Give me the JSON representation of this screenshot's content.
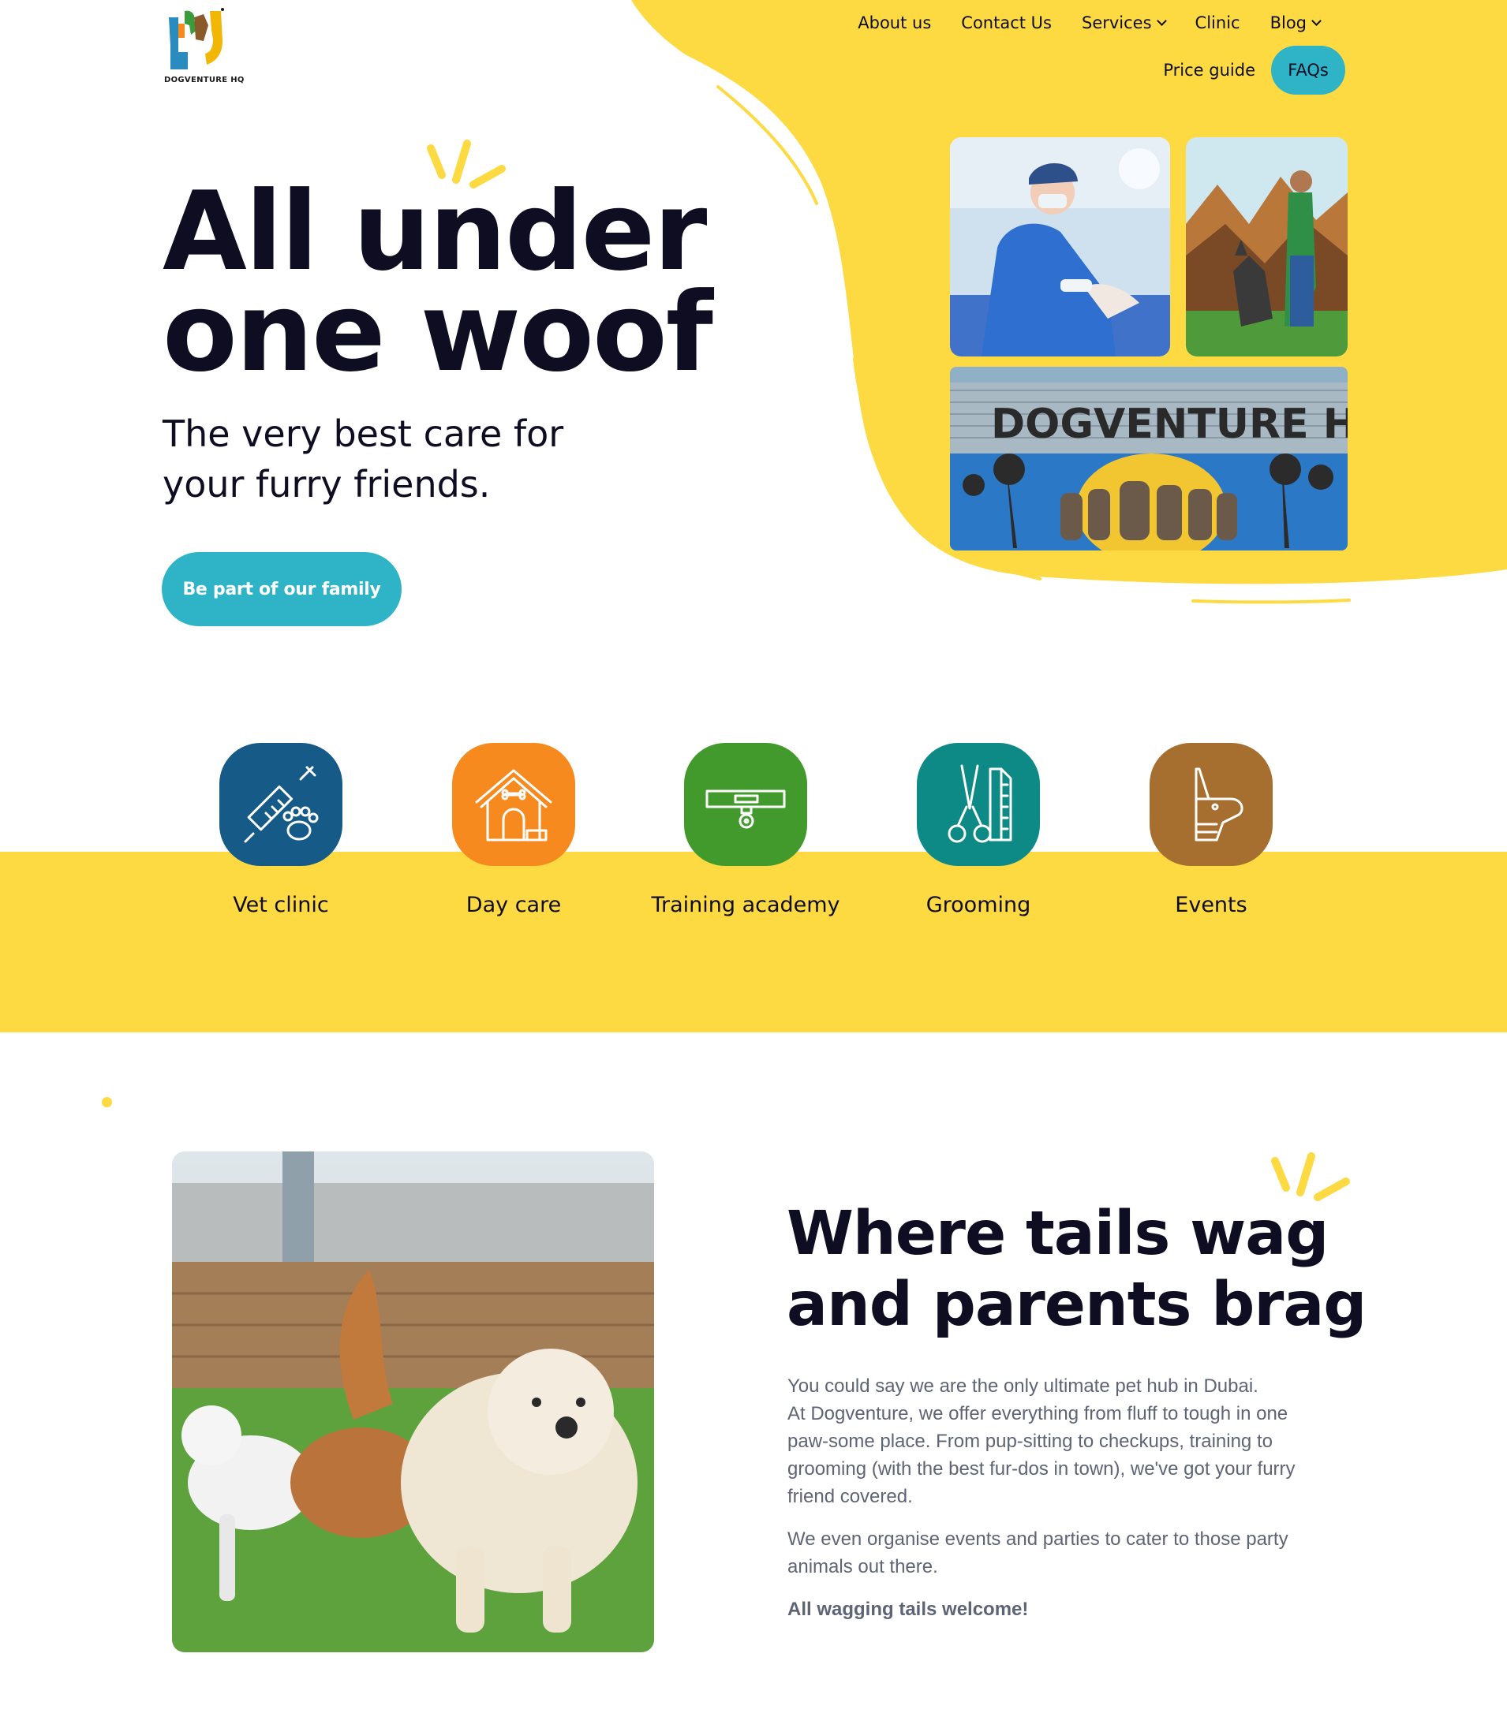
{
  "brand": {
    "logo_text": "DOGVENTURE HQ",
    "colors": {
      "yellow": "#fdd942",
      "teal": "#2fb3c6",
      "navy": "#0f0d22",
      "text_gray": "#5d6475"
    }
  },
  "nav": {
    "items": [
      {
        "label": "About us",
        "has_dropdown": false
      },
      {
        "label": "Contact Us",
        "has_dropdown": false
      },
      {
        "label": "Services",
        "has_dropdown": true
      },
      {
        "label": "Clinic",
        "has_dropdown": false
      },
      {
        "label": "Blog",
        "has_dropdown": true
      }
    ],
    "price_guide": "Price guide",
    "faqs": "FAQs"
  },
  "hero": {
    "title_line1": "All under",
    "title_line2": "one woof",
    "subtitle_line1": "The very best care for",
    "subtitle_line2": "your furry friends.",
    "cta": "Be part of our family",
    "building_sign": "DOGVENTURE HQ"
  },
  "services": [
    {
      "label": "Vet clinic",
      "icon": "syringe-paw-icon",
      "color": "#165b88"
    },
    {
      "label": "Day care",
      "icon": "dog-house-icon",
      "color": "#f68a1f"
    },
    {
      "label": "Training academy",
      "icon": "dog-collar-icon",
      "color": "#439a2c"
    },
    {
      "label": "Grooming",
      "icon": "scissors-comb-icon",
      "color": "#0d8a86"
    },
    {
      "label": "Events",
      "icon": "party-dog-icon",
      "color": "#a66f30"
    }
  ],
  "about": {
    "title_line1": "Where tails wag",
    "title_line2": "and parents brag",
    "paragraph1_line1": "You could say we are the only ultimate pet hub in Dubai.",
    "paragraph1_line2": "At Dogventure, we offer everything from fluff to tough in one paw-some place. From pup-sitting to checkups, training to grooming (with the best fur-dos in town), we've got your furry friend covered.",
    "paragraph2": "We even organise events and parties to cater to those party animals out there.",
    "closing": "All wagging tails welcome!"
  }
}
